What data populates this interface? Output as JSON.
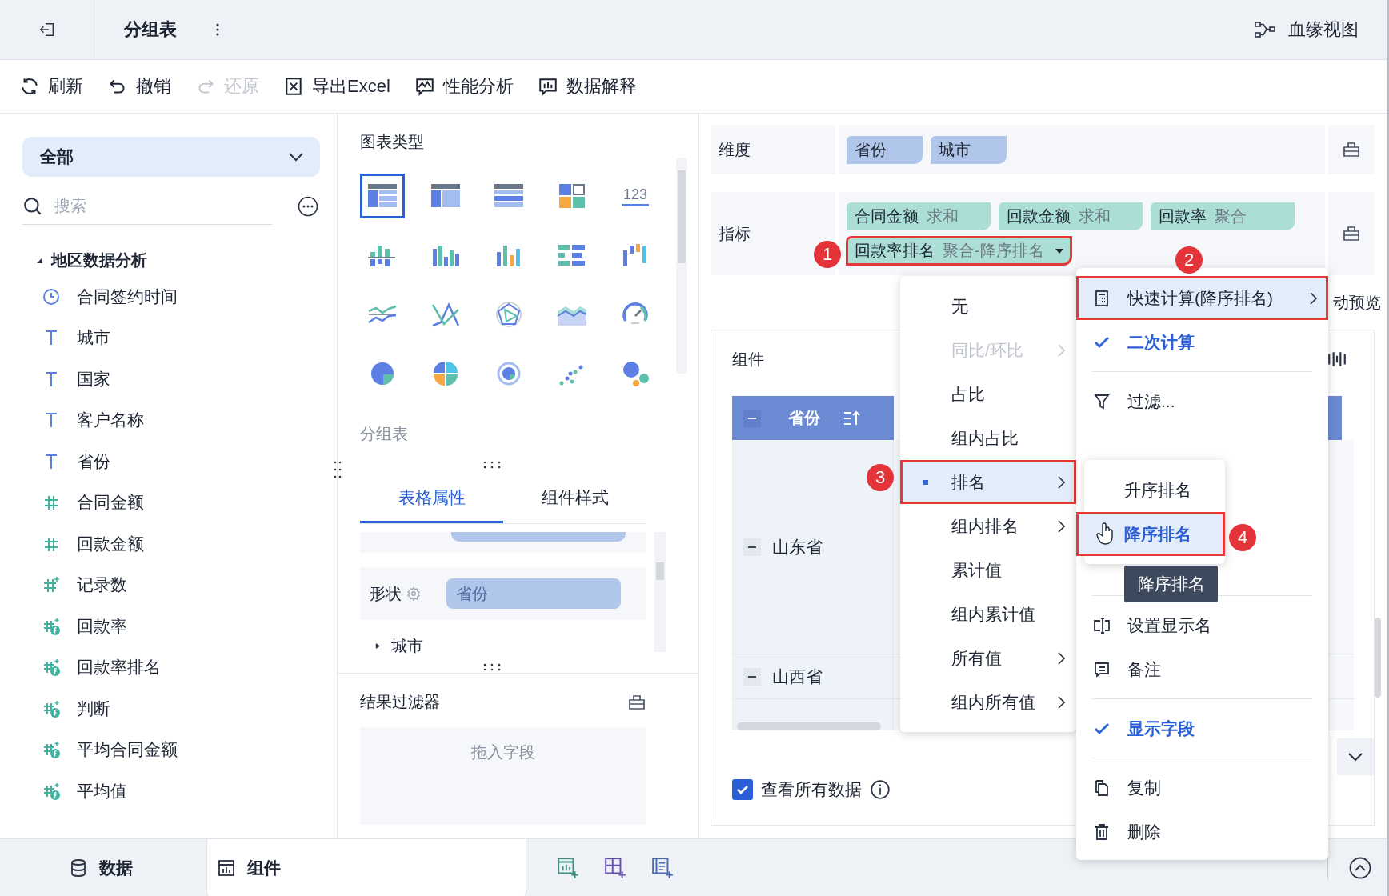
{
  "header": {
    "title": "分组表",
    "lineage": "血缘视图"
  },
  "toolbar": [
    {
      "kind": "refresh",
      "label": "刷新",
      "disabled": false
    },
    {
      "kind": "undo",
      "label": "撤销",
      "disabled": false
    },
    {
      "kind": "redo",
      "label": "还原",
      "disabled": true
    },
    {
      "kind": "excel",
      "label": "导出Excel",
      "disabled": false
    },
    {
      "kind": "performance",
      "label": "性能分析",
      "disabled": false
    },
    {
      "kind": "explain",
      "label": "数据解释",
      "disabled": false
    }
  ],
  "sidebar": {
    "scope": "全部",
    "search": {
      "placeholder": "搜索"
    },
    "group": {
      "label": "地区数据分析",
      "expanded": true,
      "children": [
        {
          "label": "合同签约时间",
          "kind": "date"
        },
        {
          "label": "城市",
          "kind": "text"
        },
        {
          "label": "国家",
          "kind": "text"
        },
        {
          "label": "客户名称",
          "kind": "text"
        },
        {
          "label": "省份",
          "kind": "text"
        },
        {
          "label": "合同金额",
          "kind": "number"
        },
        {
          "label": "回款金额",
          "kind": "number"
        },
        {
          "label": "记录数",
          "kind": "count"
        },
        {
          "label": "回款率",
          "kind": "calc"
        },
        {
          "label": "回款率排名",
          "kind": "calc"
        },
        {
          "label": "判断",
          "kind": "calc"
        },
        {
          "label": "平均合同金额",
          "kind": "calc"
        },
        {
          "label": "平均值",
          "kind": "calc"
        }
      ]
    }
  },
  "chart_types": {
    "title": "图表类型",
    "current": "分组表",
    "items": [
      {
        "kind": "group-table",
        "selected": true
      },
      {
        "kind": "cross-table",
        "selected": false
      },
      {
        "kind": "detail-table",
        "selected": false
      },
      {
        "kind": "dashboard",
        "selected": false
      },
      {
        "kind": "kpi",
        "text": "123",
        "selected": false
      },
      {
        "kind": "stacked-column",
        "selected": false
      },
      {
        "kind": "multi-column",
        "selected": false
      },
      {
        "kind": "column",
        "selected": false
      },
      {
        "kind": "bar-table",
        "selected": false
      },
      {
        "kind": "waterfall",
        "selected": false
      },
      {
        "kind": "line",
        "selected": false
      },
      {
        "kind": "multi-line",
        "selected": false
      },
      {
        "kind": "radar",
        "selected": false
      },
      {
        "kind": "area",
        "selected": false
      },
      {
        "kind": "gauge",
        "selected": false
      },
      {
        "kind": "pie",
        "selected": false
      },
      {
        "kind": "multi-pie",
        "selected": false
      },
      {
        "kind": "donut",
        "selected": false
      },
      {
        "kind": "scatter",
        "selected": false
      },
      {
        "kind": "bubble",
        "selected": false
      }
    ]
  },
  "property_tabs": [
    {
      "label": "表格属性",
      "selected": true
    },
    {
      "label": "组件样式",
      "selected": false
    }
  ],
  "properties": {
    "shape": {
      "label": "形状",
      "value": "省份"
    },
    "next_field": "城市"
  },
  "result_filter": {
    "title": "结果过滤器",
    "placeholder": "拖入字段"
  },
  "dimensions": {
    "label": "维度",
    "chips": [
      "省份",
      "城市"
    ]
  },
  "measures": {
    "label": "指标",
    "chips": [
      {
        "name": "合同金额",
        "aggregation": "求和",
        "dropdown": false,
        "outlined": false
      },
      {
        "name": "回款金额",
        "aggregation": "求和",
        "dropdown": false,
        "outlined": false
      },
      {
        "name": "回款率",
        "aggregation": "聚合",
        "dropdown": false,
        "outlined": false
      },
      {
        "name": "回款率排名",
        "aggregation": "聚合-降序排名",
        "dropdown": true,
        "outlined": true
      }
    ]
  },
  "preview": "动预览",
  "component": {
    "title": "组件",
    "table": {
      "header": "省份",
      "rows": [
        "山东省",
        "山西省"
      ]
    },
    "show_all": {
      "label": "查看所有数据",
      "checked": true
    }
  },
  "calc_menu": [
    {
      "label": "无",
      "disabled": false,
      "submenu": false,
      "selected": false,
      "outlined": false
    },
    {
      "label": "同比/环比",
      "disabled": true,
      "submenu": true,
      "selected": false,
      "outlined": false
    },
    {
      "label": "占比",
      "disabled": false,
      "submenu": false,
      "selected": false,
      "outlined": false
    },
    {
      "label": "组内占比",
      "disabled": false,
      "submenu": false,
      "selected": false,
      "outlined": false
    },
    {
      "label": "排名",
      "disabled": false,
      "submenu": true,
      "selected": true,
      "outlined": true
    },
    {
      "label": "组内排名",
      "disabled": false,
      "submenu": true,
      "selected": false,
      "outlined": false
    },
    {
      "label": "累计值",
      "disabled": false,
      "submenu": false,
      "selected": false,
      "outlined": false
    },
    {
      "label": "组内累计值",
      "disabled": false,
      "submenu": false,
      "selected": false,
      "outlined": false
    },
    {
      "label": "所有值",
      "disabled": false,
      "submenu": true,
      "selected": false,
      "outlined": false
    },
    {
      "label": "组内所有值",
      "disabled": false,
      "submenu": true,
      "selected": false,
      "outlined": false
    }
  ],
  "field_menu": {
    "top": [
      {
        "kind": "calculator",
        "label": "快速计算(降序排名)",
        "submenu": true,
        "outlined": true
      },
      {
        "kind": "check",
        "label": "二次计算",
        "checked": true
      },
      {
        "kind": "divider"
      },
      {
        "kind": "filter",
        "label": "过滤...",
        "submenu": false,
        "outlined": false
      }
    ],
    "bottom": [
      {
        "kind": "divider"
      },
      {
        "kind": "rename",
        "label": "设置显示名",
        "submenu": false,
        "outlined": false
      },
      {
        "kind": "note",
        "label": "备注",
        "submenu": false,
        "outlined": false
      },
      {
        "kind": "divider"
      },
      {
        "kind": "check",
        "label": "显示字段",
        "checked": true
      },
      {
        "kind": "divider"
      },
      {
        "kind": "copy",
        "label": "复制",
        "submenu": false,
        "outlined": false
      },
      {
        "kind": "trash",
        "label": "删除",
        "submenu": false,
        "outlined": false
      }
    ]
  },
  "rank_submenu": [
    {
      "label": "升序排名",
      "selected": false,
      "outlined": false
    },
    {
      "label": "降序排名",
      "selected": true,
      "outlined": true
    }
  ],
  "tooltip": "降序排名",
  "callouts": [
    "1",
    "2",
    "3",
    "4"
  ],
  "bottom_tabs": [
    {
      "label": "数据",
      "kind": "database",
      "selected": false
    },
    {
      "label": "组件",
      "kind": "chart",
      "selected": true
    }
  ]
}
